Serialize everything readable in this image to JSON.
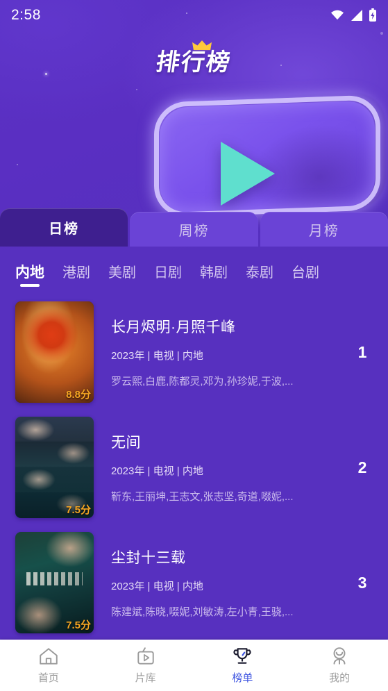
{
  "status_bar": {
    "time": "2:58",
    "icons": [
      "wifi-icon",
      "signal-icon",
      "battery-charging-icon"
    ]
  },
  "hero": {
    "logo_text": "排行榜",
    "crown_icon": "crown-icon",
    "art_icon": "play-button-3d-icon",
    "colors": {
      "bg": "#5730bf",
      "accent_play": "#5fdfce",
      "card": "#7a52ec"
    }
  },
  "period_tabs": {
    "active_index": 0,
    "items": [
      {
        "label": "日榜"
      },
      {
        "label": "周榜"
      },
      {
        "label": "月榜"
      }
    ]
  },
  "categories": {
    "active_index": 0,
    "items": [
      {
        "label": "内地"
      },
      {
        "label": "港剧"
      },
      {
        "label": "美剧"
      },
      {
        "label": "日剧"
      },
      {
        "label": "韩剧"
      },
      {
        "label": "泰剧"
      },
      {
        "label": "台剧"
      }
    ]
  },
  "list": [
    {
      "rank": "1",
      "title": "长月烬明·月照千峰",
      "meta": "2023年 | 电视 | 内地",
      "cast": "罗云熙,白鹿,陈都灵,邓为,孙珍妮,于波,...",
      "score": "8.8分",
      "poster": "poster-chang-yue-jin-ming"
    },
    {
      "rank": "2",
      "title": "无间",
      "meta": "2023年 | 电视 | 内地",
      "cast": "靳东,王丽坤,王志文,张志坚,奇道,啜妮,...",
      "score": "7.5分",
      "poster": "poster-wu-jian"
    },
    {
      "rank": "3",
      "title": "尘封十三载",
      "meta": "2023年 | 电视 | 内地",
      "cast": "陈建斌,陈晓,啜妮,刘敏涛,左小青,王骁,...",
      "score": "7.5分",
      "poster": "poster-chen-feng-shi-san-zai"
    }
  ],
  "bottom_nav": {
    "active_index": 2,
    "active_color": "#3b52e0",
    "items": [
      {
        "label": "首页",
        "icon": "home-icon"
      },
      {
        "label": "片库",
        "icon": "tv-library-icon"
      },
      {
        "label": "榜单",
        "icon": "trophy-icon"
      },
      {
        "label": "我的",
        "icon": "user-profile-icon"
      }
    ]
  }
}
